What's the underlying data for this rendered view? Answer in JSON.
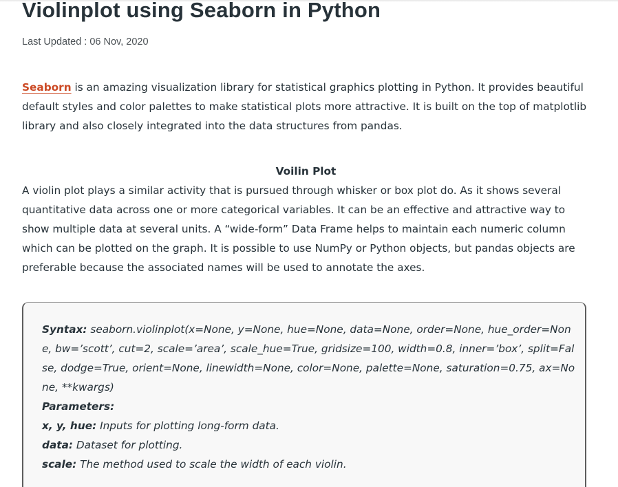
{
  "article": {
    "title": "Violinplot using Seaborn in Python",
    "last_updated": "Last Updated : 06 Nov, 2020",
    "intro": {
      "link_text": "Seaborn",
      "text": " is an amazing visualization library for statistical graphics plotting in Python. It provides beautiful default styles and color palettes to make statistical plots more attractive. It is built on the top of matplotlib library and also closely integrated into the data structures from pandas."
    },
    "section_heading": "Voilin Plot",
    "section_text": "A violin plot plays a similar activity that is pursued through whisker or box plot do. As it shows several quantitative data across one or more categorical variables. It can be an effective and attractive way to show multiple data at several units. A “wide-form” Data Frame helps to maintain each numeric column which can be plotted on the graph. It is possible to use NumPy or Python objects, but pandas objects are preferable because the associated names will be used to annotate the axes."
  },
  "code_box": {
    "syntax_label": "Syntax:",
    "syntax_text": " seaborn.violinplot(x=None, y=None, hue=None, data=None, order=None, hue_order=None, bw=’scott’, cut=2, scale=’area’, scale_hue=True, gridsize=100, width=0.8, inner=’box’, split=False, dodge=True, orient=None, linewidth=None, color=None, palette=None, saturation=0.75, ax=None, **kwargs)",
    "parameters_label": "Parameters:",
    "params": [
      {
        "name": "x, y, hue:",
        "desc": " Inputs for plotting long-form data."
      },
      {
        "name": "data:",
        "desc": " Dataset for plotting."
      },
      {
        "name": "scale:",
        "desc": " The method used to scale the width of each violin."
      }
    ]
  },
  "colors": {
    "text": "#273239",
    "link": "#cc4a25",
    "code_bg": "#f8f8f8",
    "code_border": "#5d5d5d"
  }
}
